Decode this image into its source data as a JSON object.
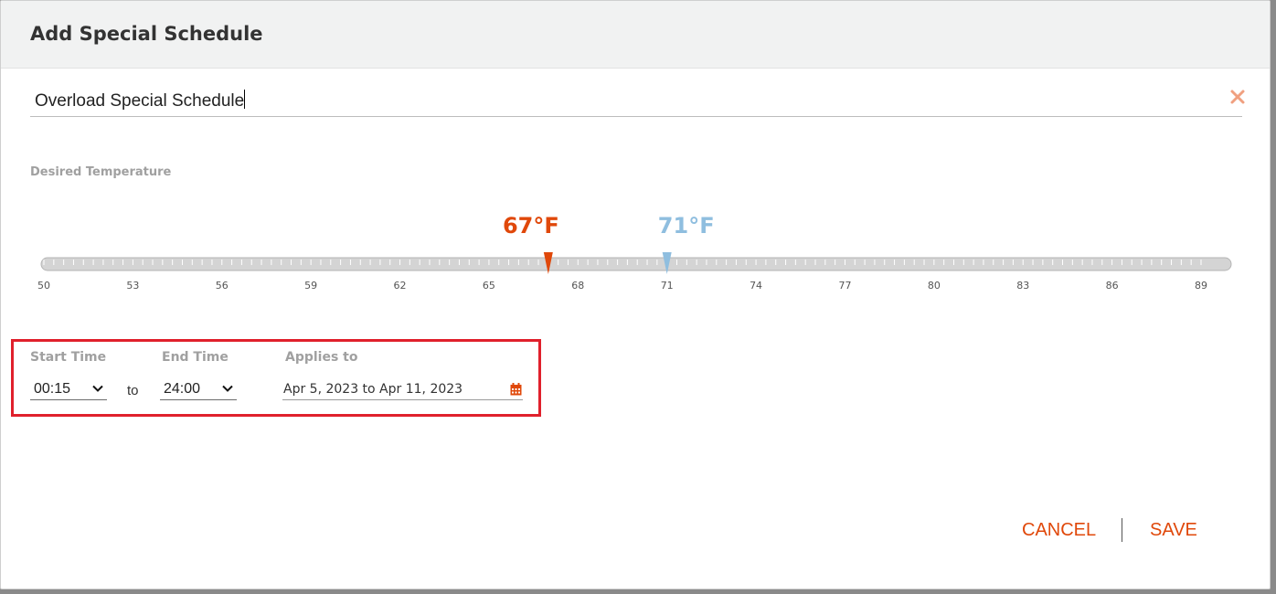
{
  "dialog": {
    "title": "Add Special Schedule",
    "name_value": "Overload Special Schedule",
    "close_icon": "close-x-icon"
  },
  "temperature": {
    "label": "Desired Temperature",
    "heat_setpoint": "67°F",
    "cool_setpoint": "71°F",
    "heat_value": 67,
    "cool_value": 71,
    "scale_min": 50,
    "scale_max": 89,
    "tick_labels": [
      "50",
      "53",
      "56",
      "59",
      "62",
      "65",
      "68",
      "71",
      "74",
      "77",
      "80",
      "83",
      "86",
      "89"
    ],
    "heat_color": "#e0480a",
    "cool_color": "#8fbedf"
  },
  "schedule": {
    "start_label": "Start Time",
    "start_value": "00:15",
    "to_text": "to",
    "end_label": "End Time",
    "end_value": "24:00",
    "applies_label": "Applies to",
    "applies_value": "Apr 5, 2023 to Apr 11, 2023",
    "calendar_icon": "calendar-icon"
  },
  "actions": {
    "cancel_label": "CANCEL",
    "save_label": "SAVE",
    "accent_color": "#e0480a"
  }
}
